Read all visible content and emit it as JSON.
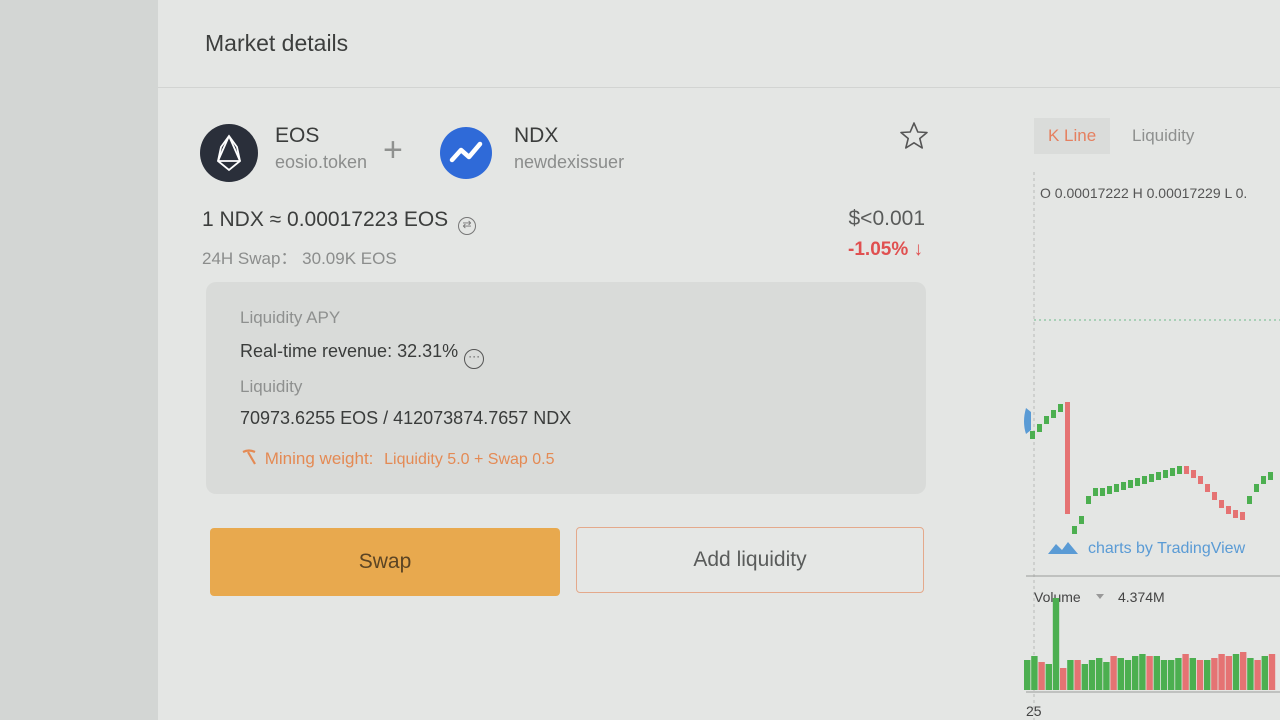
{
  "header": {
    "title": "Market details"
  },
  "pair": {
    "base": {
      "symbol": "EOS",
      "issuer": "eosio.token",
      "logo_icon": "eos-logo-icon"
    },
    "quote": {
      "symbol": "NDX",
      "issuer": "newdexissuer",
      "logo_icon": "ndx-logo-icon"
    },
    "plus": "+"
  },
  "price": {
    "rate": "1 NDX ≈ 0.00017223 EOS",
    "usd": "$<0.001",
    "change": "-1.05% ↓",
    "swap_label": "24H Swap：",
    "swap_value": "30.09K EOS"
  },
  "info": {
    "apy_label": "Liquidity APY",
    "revenue": "Real-time revenue: 32.31%",
    "liquidity_label": "Liquidity",
    "liquidity_value": "70973.6255 EOS / 412073874.7657 NDX",
    "mining_label": "Mining weight:",
    "mining_value": "Liquidity 5.0 + Swap 0.5"
  },
  "buttons": {
    "swap": "Swap",
    "add_liquidity": "Add liquidity"
  },
  "chart": {
    "tabs": [
      "K Line",
      "Liquidity"
    ],
    "active_tab": "K Line",
    "ohlc": "O 0.00017222  H 0.00017229  L 0.",
    "watermark": "charts by TradingView",
    "volume_label": "Volume",
    "volume_value": "4.374M",
    "x_tick": "25"
  },
  "colors": {
    "up": "#4caf50",
    "down": "#e57373",
    "accent": "#e8a94e"
  }
}
